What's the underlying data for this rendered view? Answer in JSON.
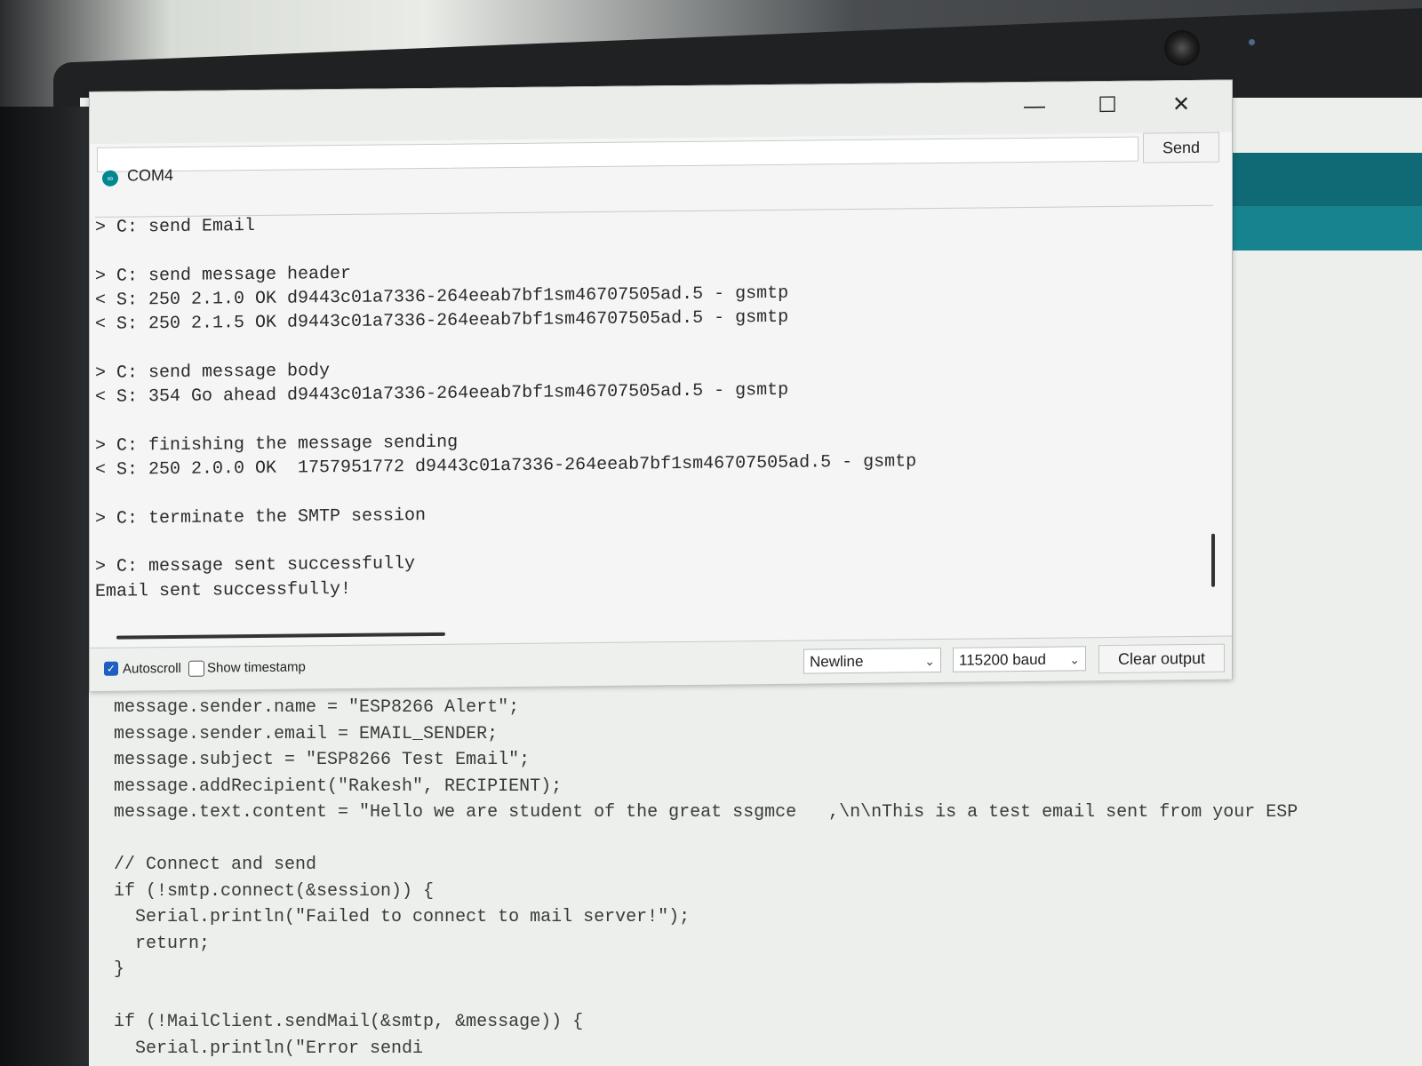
{
  "window": {
    "title": "COM4",
    "app_icon_text": "∞",
    "minimize_glyph": "—",
    "maximize_glyph": "☐",
    "close_glyph": "✕",
    "send_label": "Send",
    "message_input_value": ""
  },
  "output_lines": [
    "> C: send Email",
    "",
    "> C: send message header",
    "< S: 250 2.1.0 OK d9443c01a7336-264eeab7bf1sm46707505ad.5 - gsmtp",
    "< S: 250 2.1.5 OK d9443c01a7336-264eeab7bf1sm46707505ad.5 - gsmtp",
    "",
    "> C: send message body",
    "< S: 354 Go ahead d9443c01a7336-264eeab7bf1sm46707505ad.5 - gsmtp",
    "",
    "> C: finishing the message sending",
    "< S: 250 2.0.0 OK  1757951772 d9443c01a7336-264eeab7bf1sm46707505ad.5 - gsmtp",
    "",
    "> C: terminate the SMTP session",
    "",
    "> C: message sent successfully",
    "Email sent successfully!"
  ],
  "footer": {
    "autoscroll_label": "Autoscroll",
    "autoscroll_checked": true,
    "timestamp_label": "Show timestamp",
    "timestamp_checked": false,
    "line_ending_value": "Newline",
    "baud_value": "115200 baud",
    "clear_label": "Clear output"
  },
  "code_lines": [
    "message.sender.name = \"ESP8266 Alert\";",
    "message.sender.email = EMAIL_SENDER;",
    "message.subject = \"ESP8266 Test Email\";",
    "message.addRecipient(\"Rakesh\", RECIPIENT);",
    "message.text.content = \"Hello we are student of the great ssgmce   ,\\n\\nThis is a test email sent from your ESP",
    "",
    "// Connect and send",
    "if (!smtp.connect(&session)) {",
    "  Serial.println(\"Failed to connect to mail server!\");",
    "  return;",
    "}",
    "",
    "if (!MailClient.sendMail(&smtp, &message)) {",
    "  Serial.println(\"Error sendi"
  ],
  "colors": {
    "accent_blue": "#1f5fbf",
    "arduino_teal": "#00878f",
    "keyword_orange": "#c1740b"
  }
}
